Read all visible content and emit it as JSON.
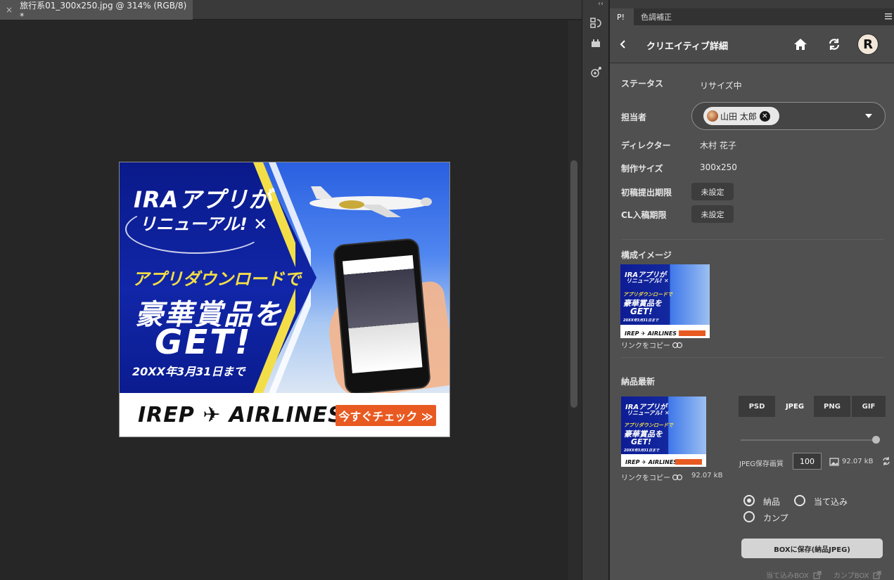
{
  "document": {
    "tab_close": "×",
    "tab_title": "旅行系01_300x250.jpg @ 314% (RGB/8) *"
  },
  "banner": {
    "headline1": "IRAアプリが",
    "headline2": "リニューアル! ✕",
    "subhead": "アプリダウンロードで",
    "big_line": "豪華賞品を",
    "get_line": "GET!",
    "deadline": "20XX年3月31日まで",
    "logo": "IREP ✈ AIRLINES",
    "cta": "今すぐチェック ≫"
  },
  "panel": {
    "collapse": "‹‹",
    "tabs": [
      {
        "label": "P!"
      },
      {
        "label": "色調補正"
      }
    ],
    "header_title": "クリエイティブ詳細",
    "avatar_letter": "R",
    "fields": {
      "status_label": "ステータス",
      "status_value": "リサイズ中",
      "assignee_label": "担当者",
      "assignee_name": "山田 太郎",
      "director_label": "ディレクター",
      "director_value": "木村 花子",
      "size_label": "制作サイズ",
      "size_value": "300x250",
      "first_deadline_label": "初稿提出期限",
      "first_deadline_value": "未設定",
      "cl_deadline_label": "CL入稿期限",
      "cl_deadline_value": "未設定"
    },
    "composition": {
      "title": "構成イメージ",
      "copy_link": "リンクをコピー"
    },
    "delivery": {
      "title": "納品最新",
      "copy_link": "リンクをコピー",
      "file_size": "92.07 kB",
      "formats": [
        "PSD",
        "JPEG",
        "PNG",
        "GIF"
      ],
      "selected_format": "JPEG",
      "quality_label": "JPEG保存画質",
      "quality_value": "100",
      "quality_level": 1.0,
      "output_size": "92.07 kB",
      "radio_options": [
        "納品",
        "当て込み",
        "カンプ"
      ],
      "radio_selected": "納品",
      "save_button": "BOXに保存(納品JPEG)",
      "footer_links": [
        "当て込みBOX",
        "カンプBOX"
      ]
    }
  },
  "thumb_text": {
    "t1": "IRAアプリが",
    "t2": "リニューアル! ✕",
    "t3": "アプリダウンロードで",
    "t4": "豪華賞品を",
    "t5": "GET!",
    "t6": "20XX年3月31日まで",
    "logo": "IREP ✈ AIRLINES",
    "cta": "今すぐチェック ≫"
  },
  "colors": {
    "accent_orange": "#e85a21",
    "banner_blue": "#1126a8",
    "banner_yellow": "#f3de47",
    "panel_bg": "#505050"
  }
}
